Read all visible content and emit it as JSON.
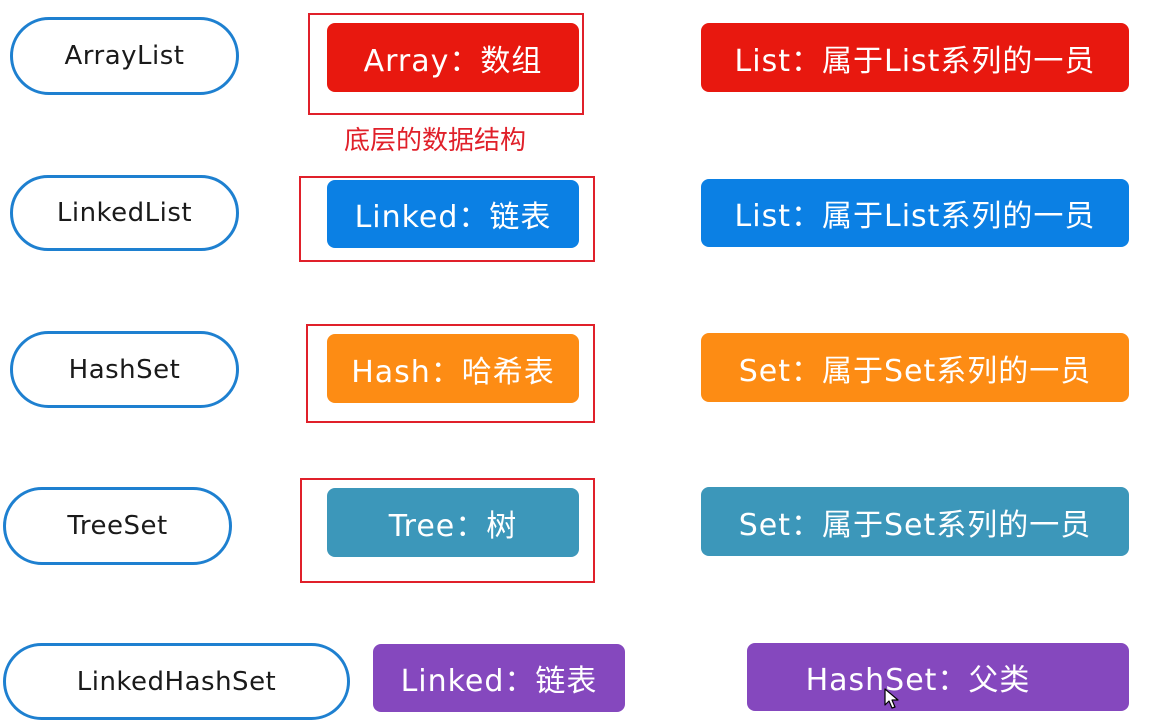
{
  "rows": [
    {
      "class_name": "ArrayList",
      "structure": "Array：数组",
      "family": "List：属于List系列的一员",
      "color": "#e8180f"
    },
    {
      "class_name": "LinkedList",
      "structure": "Linked：链表",
      "family": "List：属于List系列的一员",
      "color": "#0b80e4"
    },
    {
      "class_name": "HashSet",
      "structure": "Hash：哈希表",
      "family": "Set：属于Set系列的一员",
      "color": "#fd8c14"
    },
    {
      "class_name": "TreeSet",
      "structure": "Tree：树",
      "family": "Set：属于Set系列的一员",
      "color": "#3c97ba"
    },
    {
      "class_name": "LinkedHashSet",
      "structure": "Linked：链表",
      "family": "HashSet：父类",
      "color": "#8548be"
    }
  ],
  "note": "底层的数据结构",
  "icons": {
    "cursor": "mouse-pointer-icon"
  }
}
